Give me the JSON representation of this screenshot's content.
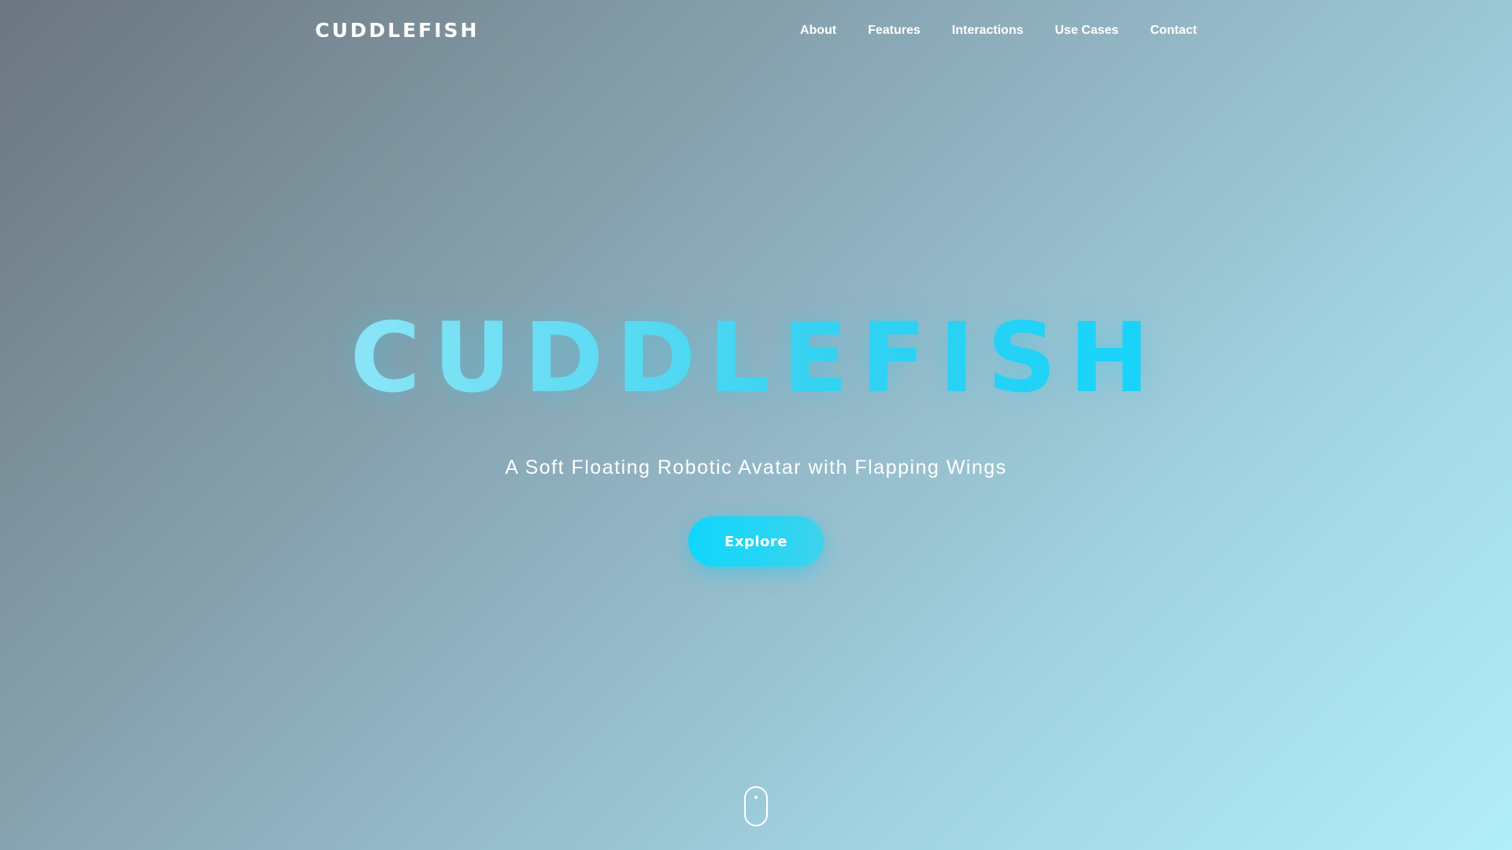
{
  "nav": {
    "brand": "CUDDLEFISH",
    "links": [
      {
        "label": "About"
      },
      {
        "label": "Features"
      },
      {
        "label": "Interactions"
      },
      {
        "label": "Use Cases"
      },
      {
        "label": "Contact"
      }
    ]
  },
  "hero": {
    "title": "CUDDLEFISH",
    "subtitle": "A Soft Floating Robotic Avatar with Flapping Wings",
    "cta_label": "Explore"
  },
  "scroll_indicator": {
    "icon": "mouse-scroll-icon"
  },
  "colors": {
    "accent": "#10d6fb",
    "title_gradient_start": "#c6f1fa",
    "title_gradient_end": "#0ecff9",
    "background_start": "#6c7581",
    "background_end": "#b1eef9",
    "text": "#ffffff"
  }
}
